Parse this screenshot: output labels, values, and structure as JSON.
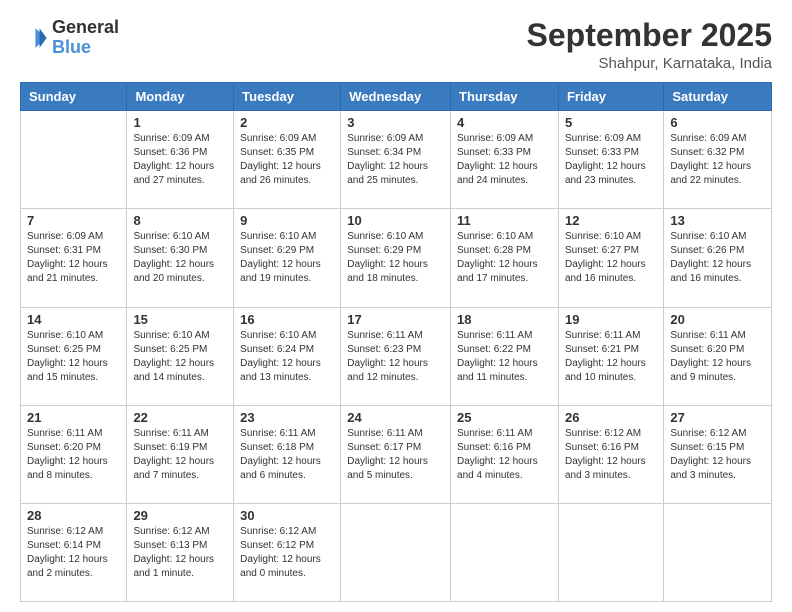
{
  "logo": {
    "line1": "General",
    "line2": "Blue"
  },
  "header": {
    "month": "September 2025",
    "location": "Shahpur, Karnataka, India"
  },
  "weekdays": [
    "Sunday",
    "Monday",
    "Tuesday",
    "Wednesday",
    "Thursday",
    "Friday",
    "Saturday"
  ],
  "weeks": [
    [
      {
        "day": "",
        "info": ""
      },
      {
        "day": "1",
        "info": "Sunrise: 6:09 AM\nSunset: 6:36 PM\nDaylight: 12 hours\nand 27 minutes."
      },
      {
        "day": "2",
        "info": "Sunrise: 6:09 AM\nSunset: 6:35 PM\nDaylight: 12 hours\nand 26 minutes."
      },
      {
        "day": "3",
        "info": "Sunrise: 6:09 AM\nSunset: 6:34 PM\nDaylight: 12 hours\nand 25 minutes."
      },
      {
        "day": "4",
        "info": "Sunrise: 6:09 AM\nSunset: 6:33 PM\nDaylight: 12 hours\nand 24 minutes."
      },
      {
        "day": "5",
        "info": "Sunrise: 6:09 AM\nSunset: 6:33 PM\nDaylight: 12 hours\nand 23 minutes."
      },
      {
        "day": "6",
        "info": "Sunrise: 6:09 AM\nSunset: 6:32 PM\nDaylight: 12 hours\nand 22 minutes."
      }
    ],
    [
      {
        "day": "7",
        "info": "Sunrise: 6:09 AM\nSunset: 6:31 PM\nDaylight: 12 hours\nand 21 minutes."
      },
      {
        "day": "8",
        "info": "Sunrise: 6:10 AM\nSunset: 6:30 PM\nDaylight: 12 hours\nand 20 minutes."
      },
      {
        "day": "9",
        "info": "Sunrise: 6:10 AM\nSunset: 6:29 PM\nDaylight: 12 hours\nand 19 minutes."
      },
      {
        "day": "10",
        "info": "Sunrise: 6:10 AM\nSunset: 6:29 PM\nDaylight: 12 hours\nand 18 minutes."
      },
      {
        "day": "11",
        "info": "Sunrise: 6:10 AM\nSunset: 6:28 PM\nDaylight: 12 hours\nand 17 minutes."
      },
      {
        "day": "12",
        "info": "Sunrise: 6:10 AM\nSunset: 6:27 PM\nDaylight: 12 hours\nand 16 minutes."
      },
      {
        "day": "13",
        "info": "Sunrise: 6:10 AM\nSunset: 6:26 PM\nDaylight: 12 hours\nand 16 minutes."
      }
    ],
    [
      {
        "day": "14",
        "info": "Sunrise: 6:10 AM\nSunset: 6:25 PM\nDaylight: 12 hours\nand 15 minutes."
      },
      {
        "day": "15",
        "info": "Sunrise: 6:10 AM\nSunset: 6:25 PM\nDaylight: 12 hours\nand 14 minutes."
      },
      {
        "day": "16",
        "info": "Sunrise: 6:10 AM\nSunset: 6:24 PM\nDaylight: 12 hours\nand 13 minutes."
      },
      {
        "day": "17",
        "info": "Sunrise: 6:11 AM\nSunset: 6:23 PM\nDaylight: 12 hours\nand 12 minutes."
      },
      {
        "day": "18",
        "info": "Sunrise: 6:11 AM\nSunset: 6:22 PM\nDaylight: 12 hours\nand 11 minutes."
      },
      {
        "day": "19",
        "info": "Sunrise: 6:11 AM\nSunset: 6:21 PM\nDaylight: 12 hours\nand 10 minutes."
      },
      {
        "day": "20",
        "info": "Sunrise: 6:11 AM\nSunset: 6:20 PM\nDaylight: 12 hours\nand 9 minutes."
      }
    ],
    [
      {
        "day": "21",
        "info": "Sunrise: 6:11 AM\nSunset: 6:20 PM\nDaylight: 12 hours\nand 8 minutes."
      },
      {
        "day": "22",
        "info": "Sunrise: 6:11 AM\nSunset: 6:19 PM\nDaylight: 12 hours\nand 7 minutes."
      },
      {
        "day": "23",
        "info": "Sunrise: 6:11 AM\nSunset: 6:18 PM\nDaylight: 12 hours\nand 6 minutes."
      },
      {
        "day": "24",
        "info": "Sunrise: 6:11 AM\nSunset: 6:17 PM\nDaylight: 12 hours\nand 5 minutes."
      },
      {
        "day": "25",
        "info": "Sunrise: 6:11 AM\nSunset: 6:16 PM\nDaylight: 12 hours\nand 4 minutes."
      },
      {
        "day": "26",
        "info": "Sunrise: 6:12 AM\nSunset: 6:16 PM\nDaylight: 12 hours\nand 3 minutes."
      },
      {
        "day": "27",
        "info": "Sunrise: 6:12 AM\nSunset: 6:15 PM\nDaylight: 12 hours\nand 3 minutes."
      }
    ],
    [
      {
        "day": "28",
        "info": "Sunrise: 6:12 AM\nSunset: 6:14 PM\nDaylight: 12 hours\nand 2 minutes."
      },
      {
        "day": "29",
        "info": "Sunrise: 6:12 AM\nSunset: 6:13 PM\nDaylight: 12 hours\nand 1 minute."
      },
      {
        "day": "30",
        "info": "Sunrise: 6:12 AM\nSunset: 6:12 PM\nDaylight: 12 hours\nand 0 minutes."
      },
      {
        "day": "",
        "info": ""
      },
      {
        "day": "",
        "info": ""
      },
      {
        "day": "",
        "info": ""
      },
      {
        "day": "",
        "info": ""
      }
    ]
  ]
}
